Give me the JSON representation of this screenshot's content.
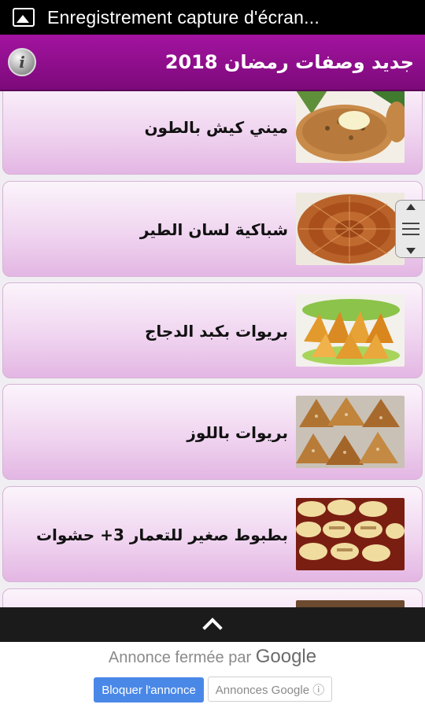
{
  "status_bar": {
    "notification_text": "Enregistrement capture d'écran..."
  },
  "app_bar": {
    "title": "جديد وصفات رمضان 2018"
  },
  "recipes": [
    {
      "label": "ميني كيش بالطون"
    },
    {
      "label": "شباكية لسان الطير"
    },
    {
      "label": "بريوات بكبد الدجاج"
    },
    {
      "label": "بريوات باللوز"
    },
    {
      "label": "بطبوط صغير للتعمار 3+ حشوات"
    },
    {
      "label": ""
    }
  ],
  "ad": {
    "closed_text": "Annonce fermée par",
    "brand": "Google",
    "block_button": "Bloquer l'annonce",
    "google_ads_button": "Annonces Google ⓘ"
  },
  "colors": {
    "app_bar": "#8f0f8d",
    "card_gradient_end": "#e3b6e3",
    "block_button": "#4a88e8"
  }
}
